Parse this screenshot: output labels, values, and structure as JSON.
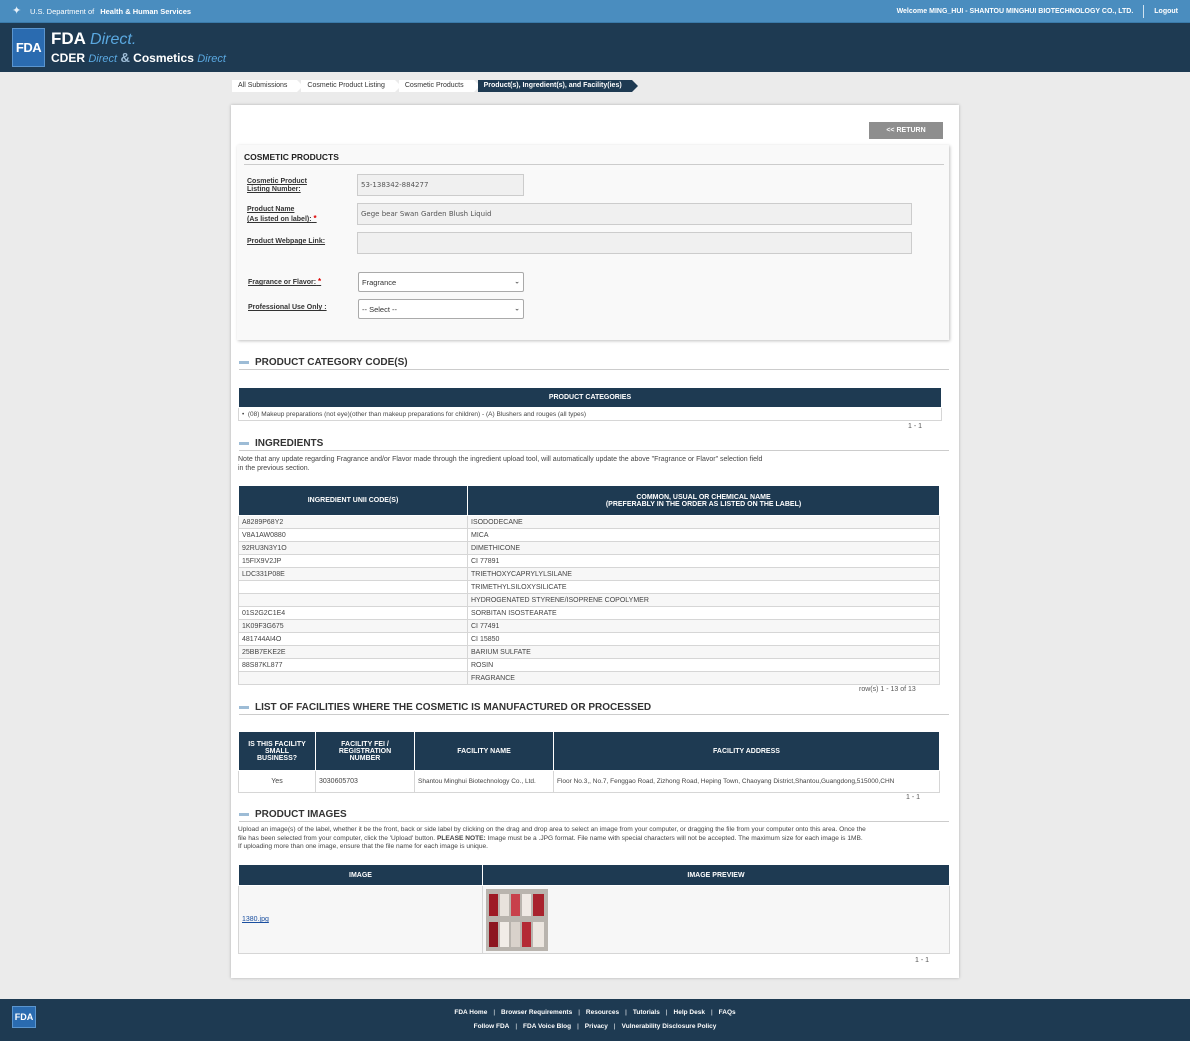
{
  "hhs": {
    "prefix": "U.S. Department of",
    "name": "Health & Human Services",
    "welcome": "Welcome MING_HUI - SHANTOU MINGHUI BIOTECHNOLOGY CO., LTD.",
    "logout": "Logout"
  },
  "header": {
    "fda": "FDA",
    "fda_word": "FDA",
    "direct1": "Direct.",
    "cder": "CDER",
    "direct2": "Direct",
    "amp": "&",
    "cosmetics": "Cosmetics",
    "direct3": "Direct"
  },
  "breadcrumb": [
    "All Submissions",
    "Cosmetic Product Listing",
    "Cosmetic Products",
    "Product(s), Ingredient(s), and Facility(ies)"
  ],
  "return_label": "<< RETURN",
  "cosmetic_products": {
    "title": "COSMETIC PRODUCTS",
    "listing_label_1": "Cosmetic Product",
    "listing_label_2": "Listing Number:",
    "listing_value": "53-138342-884277",
    "name_label_1": "Product Name",
    "name_label_2": "(As listed on label):",
    "name_value": "Gege bear Swan Garden Blush Liquid",
    "web_label": "Product Webpage Link:",
    "web_value": "",
    "fragrance_label": "Fragrance or Flavor:",
    "fragrance_value": "Fragrance",
    "pro_label": "Professional Use Only :",
    "pro_value": "-- Select --",
    "required_mark": "*"
  },
  "categories": {
    "title": "PRODUCT CATEGORY CODE(S)",
    "header": "PRODUCT CATEGORIES",
    "item": "(08) Makeup preparations (not eye)(other than makeup preparations for children) - (A) Blushers and rouges (all types)",
    "pager": "1 - 1"
  },
  "ingredients": {
    "title": "INGREDIENTS",
    "note_1": "Note that any update regarding Fragrance and/or Flavor made through the ingredient upload tool, will automatically update the above \"Fragrance or Flavor\" selection field",
    "note_2": "in the previous section.",
    "col1": "INGREDIENT UNII CODE(S)",
    "col2_1": "COMMON, USUAL OR CHEMICAL NAME",
    "col2_2": "(PREFERABLY IN THE ORDER AS LISTED ON THE LABEL)",
    "rows": [
      [
        "A8289P68Y2",
        "ISODODECANE"
      ],
      [
        "V8A1AW0880",
        "MICA"
      ],
      [
        "92RU3N3Y1O",
        "DIMETHICONE"
      ],
      [
        "15FIX9V2JP",
        "CI 77891"
      ],
      [
        "LDC331P08E",
        "TRIETHOXYCAPRYLYLSILANE"
      ],
      [
        "",
        "TRIMETHYLSILOXYSILICATE"
      ],
      [
        "",
        "HYDROGENATED STYRENE/ISOPRENE COPOLYMER"
      ],
      [
        "01S2G2C1E4",
        "SORBITAN ISOSTEARATE"
      ],
      [
        "1K09F3G675",
        "CI 77491"
      ],
      [
        "481744AI4O",
        "CI 15850"
      ],
      [
        "25BB7EKE2E",
        "BARIUM SULFATE"
      ],
      [
        "88S87KL877",
        "ROSIN"
      ],
      [
        "",
        "FRAGRANCE"
      ]
    ],
    "pager": "row(s) 1 - 13 of 13"
  },
  "facilities": {
    "title": "LIST OF FACILITIES WHERE THE COSMETIC IS MANUFACTURED OR PROCESSED",
    "col1_1": "IS THIS FACILITY",
    "col1_2": "SMALL",
    "col1_3": "BUSINESS?",
    "col2_1": "FACILITY FEI /",
    "col2_2": "REGISTRATION",
    "col2_3": "NUMBER",
    "col3": "FACILITY NAME",
    "col4": "FACILITY ADDRESS",
    "small": "Yes",
    "fei": "3030605703",
    "name": "Shantou Minghui Biotechnology Co., Ltd.",
    "address": "Floor No.3,, No.7, Fenggao Road, Zizhong Road, Heping Town, Chaoyang District,Shantou,Guangdong,515000,CHN",
    "pager": "1 - 1"
  },
  "images": {
    "title": "PRODUCT IMAGES",
    "note_1": "Upload an image(s) of the label, whether it be the front, back or side label by clicking on the drag and drop area to select an image from your computer, or dragging the file from your computer onto this area. Once the",
    "note_2a": "file has been selected from your computer, click the 'Upload' button.",
    "note_2b": "PLEASE NOTE:",
    "note_2c": "Image must be a .JPG format. File name with special characters will not be accepted. The maximum size for each image is 1MB.",
    "note_3": "If uploading more than one image, ensure that the file name for each image is unique.",
    "col1": "IMAGE",
    "col2": "IMAGE PREVIEW",
    "file": "1380.jpg",
    "pager": "1 - 1"
  },
  "footer": {
    "logo": "FDA",
    "row1": [
      "FDA Home",
      "Browser Requirements",
      "Resources",
      "Tutorials",
      "Help Desk",
      "FAQs"
    ],
    "row2": [
      "Follow FDA",
      "FDA Voice Blog",
      "Privacy",
      "Vulnerability Disclosure Policy"
    ],
    "sep": "|"
  }
}
